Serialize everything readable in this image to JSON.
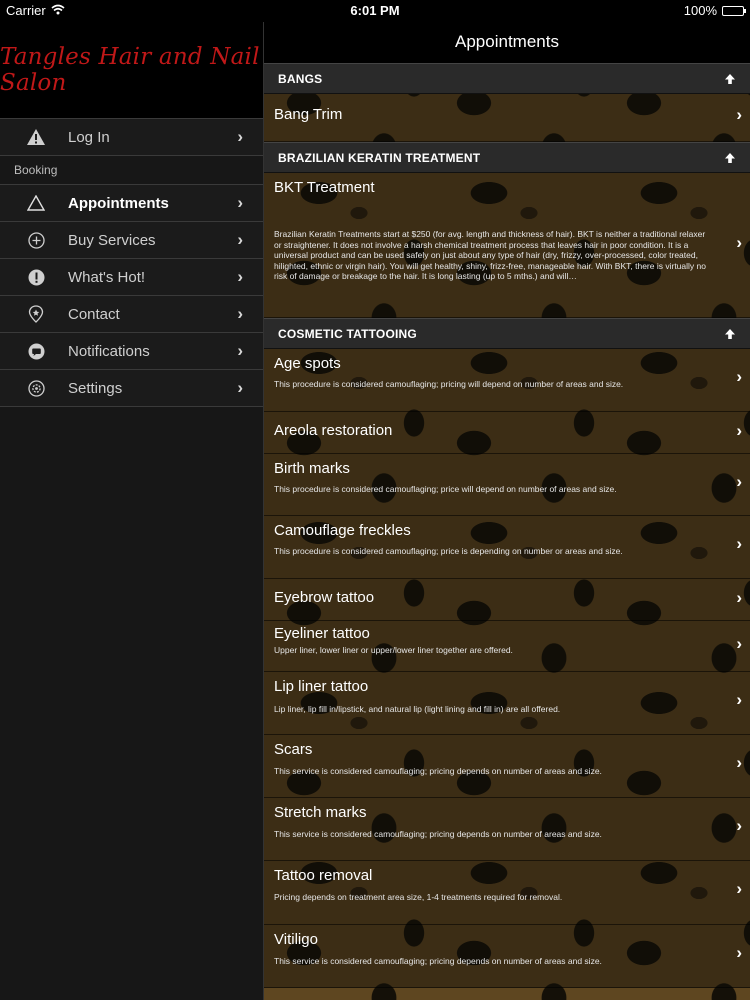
{
  "status": {
    "carrier": "Carrier",
    "time": "6:01 PM",
    "battery": "100%"
  },
  "sidebar": {
    "logo": "Tangles Hair and Nail Salon",
    "login": {
      "label": "Log In",
      "icon": "warning-icon"
    },
    "section_label": "Booking",
    "items": [
      {
        "label": "Appointments",
        "icon": "triangle-outline-icon",
        "active": true
      },
      {
        "label": "Buy Services",
        "icon": "plus-circle-icon"
      },
      {
        "label": "What's Hot!",
        "icon": "exclamation-circle-icon"
      },
      {
        "label": "Contact",
        "icon": "location-pin-icon"
      },
      {
        "label": "Notifications",
        "icon": "chat-bubble-icon"
      },
      {
        "label": "Settings",
        "icon": "gear-icon"
      }
    ]
  },
  "main": {
    "title": "Appointments",
    "sections": [
      {
        "header": "BANGS",
        "items": [
          {
            "title": "Bang Trim"
          }
        ]
      },
      {
        "header": "BRAZILIAN KERATIN TREATMENT",
        "items": [
          {
            "title": "BKT Treatment",
            "sub": "Brazilian Keratin Treatments start at $250 (for avg. length and thickness of hair). BKT is neither a traditional relaxer or straightener. It does not involve a harsh chemical treatment process that leaves hair in poor condition. It is a universal product and can be used safely on just about any type of hair (dry, frizzy, over-processed, color treated, hilighted, ethnic or virgin hair). You will get healthy, shiny, frizz-free, manageable hair. With BKT, there is virtually no risk of damage or breakage to the hair. It is long lasting (up to 5 mths.) and will…"
          }
        ]
      },
      {
        "header": "COSMETIC TATTOOING",
        "items": [
          {
            "title": "Age spots",
            "sub": "This procedure is considered camouflaging;  pricing will depend on number of areas and size."
          },
          {
            "title": "Areola restoration"
          },
          {
            "title": "Birth marks",
            "sub": "This procedure is considered camouflaging; price will depend on number of areas and size."
          },
          {
            "title": "Camouflage freckles",
            "sub": "This procedure is considered camouflaging; price is depending on number or areas and size."
          },
          {
            "title": "Eyebrow tattoo"
          },
          {
            "title": "Eyeliner tattoo",
            "sub": "Upper liner, lower liner or upper/lower liner together are offered."
          },
          {
            "title": "Lip liner tattoo",
            "sub": "Lip liner, lip fill in/lipstick, and natural lip (light lining and fill in) are all offered."
          },
          {
            "title": "Scars",
            "sub": "This service is considered camouflaging;  pricing depends on number of areas and size."
          },
          {
            "title": "Stretch marks",
            "sub": "This service is considered camouflaging;  pricing depends on number of areas and size."
          },
          {
            "title": "Tattoo removal",
            "sub": "Pricing depends on treatment area size, 1-4 treatments required for removal."
          },
          {
            "title": "Vitiligo",
            "sub": "This service is considered camouflaging; pricing depends on number of areas and size."
          }
        ]
      }
    ]
  }
}
